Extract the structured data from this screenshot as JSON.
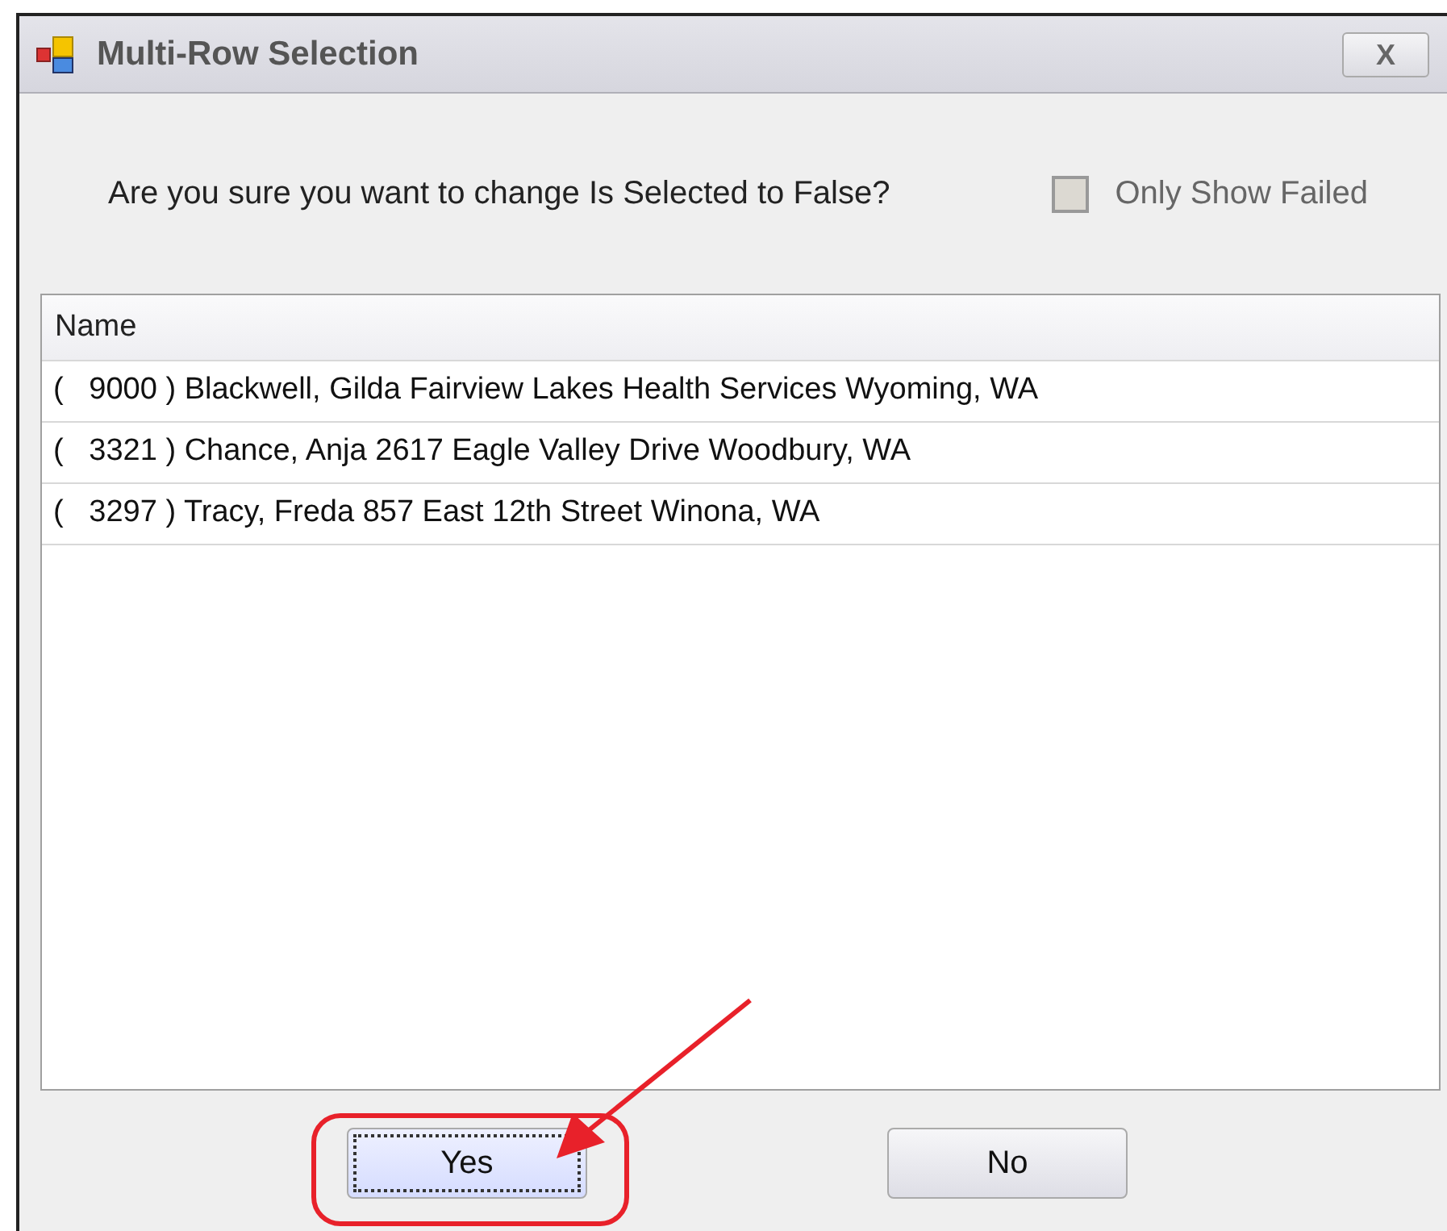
{
  "window": {
    "title": "Multi-Row Selection",
    "close": "X"
  },
  "prompt": "Are you sure you want to change Is Selected to False?",
  "only_show_failed": {
    "label": "Only Show Failed",
    "checked": false,
    "disabled": true
  },
  "table": {
    "columns": [
      "Name"
    ],
    "rows": [
      "(   9000 ) Blackwell, Gilda Fairview Lakes Health Services Wyoming, WA",
      "(   3321 ) Chance, Anja 2617 Eagle Valley Drive Woodbury, WA",
      "(   3297 ) Tracy, Freda 857 East 12th Street Winona, WA"
    ]
  },
  "buttons": [
    {
      "label": "Yes",
      "focused": true
    },
    {
      "label": "No",
      "focused": false
    }
  ]
}
